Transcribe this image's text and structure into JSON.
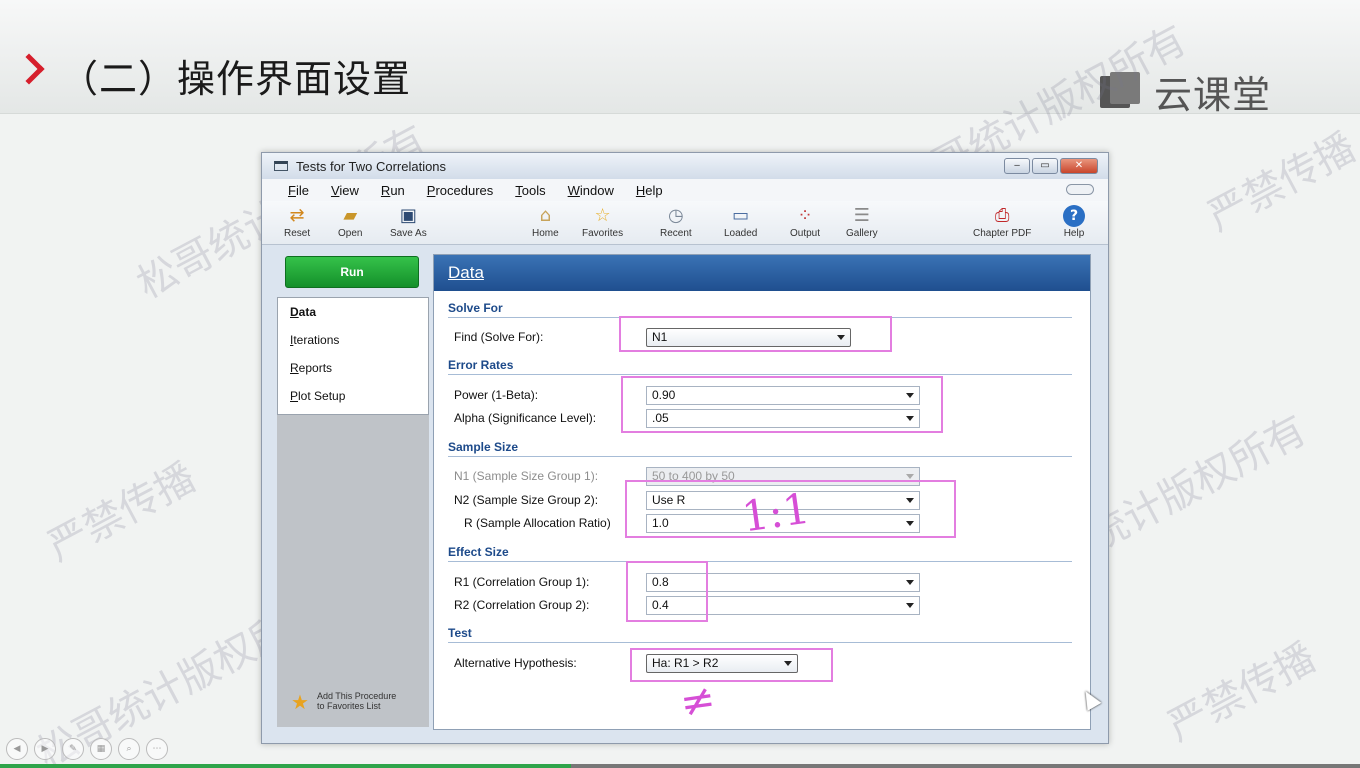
{
  "slide": {
    "title": "（二）操作界面设置",
    "brand": "云课堂",
    "watermarks": [
      "松哥统计版权所有",
      "严禁传播"
    ]
  },
  "window": {
    "title": "Tests for Two Correlations",
    "controls": [
      "‒",
      "▭",
      "✕"
    ],
    "menu": [
      "File",
      "View",
      "Run",
      "Procedures",
      "Tools",
      "Window",
      "Help"
    ],
    "toolbar": {
      "reset": "Reset",
      "open": "Open",
      "save_as": "Save As",
      "home": "Home",
      "favorites": "Favorites",
      "recent": "Recent",
      "loaded": "Loaded",
      "output": "Output",
      "gallery": "Gallery",
      "chapter_pdf": "Chapter PDF",
      "help": "Help"
    },
    "run_label": "Run",
    "nav_tabs": [
      "Data",
      "Iterations",
      "Reports",
      "Plot Setup"
    ],
    "favorites_link": "Add This Procedure to Favorites List",
    "panel_title": "Data",
    "sections": {
      "solve_for": "Solve For",
      "error_rates": "Error Rates",
      "sample_size": "Sample Size",
      "effect_size": "Effect Size",
      "test": "Test"
    },
    "fields": {
      "find": {
        "label": "Find (Solve For):",
        "value": "N1"
      },
      "power": {
        "label": "Power (1-Beta):",
        "value": "0.90"
      },
      "alpha": {
        "label": "Alpha (Significance Level):",
        "value": ".05"
      },
      "n1": {
        "label": "N1 (Sample Size Group 1):",
        "value": "50 to 400 by 50"
      },
      "n2": {
        "label": "N2 (Sample Size Group 2):",
        "value": "Use R"
      },
      "r": {
        "label": "R (Sample Allocation Ratio)",
        "value": "1.0"
      },
      "r1": {
        "label": "R1 (Correlation Group 1):",
        "value": "0.8"
      },
      "r2": {
        "label": "R2 (Correlation Group 2):",
        "value": "0.4"
      },
      "alt": {
        "label": "Alternative Hypothesis:",
        "value": "Ha: R1 > R2"
      }
    }
  },
  "annotations": {
    "ratio": "1:1",
    "hyp": "≠"
  },
  "player": {
    "progress": 0.42
  }
}
